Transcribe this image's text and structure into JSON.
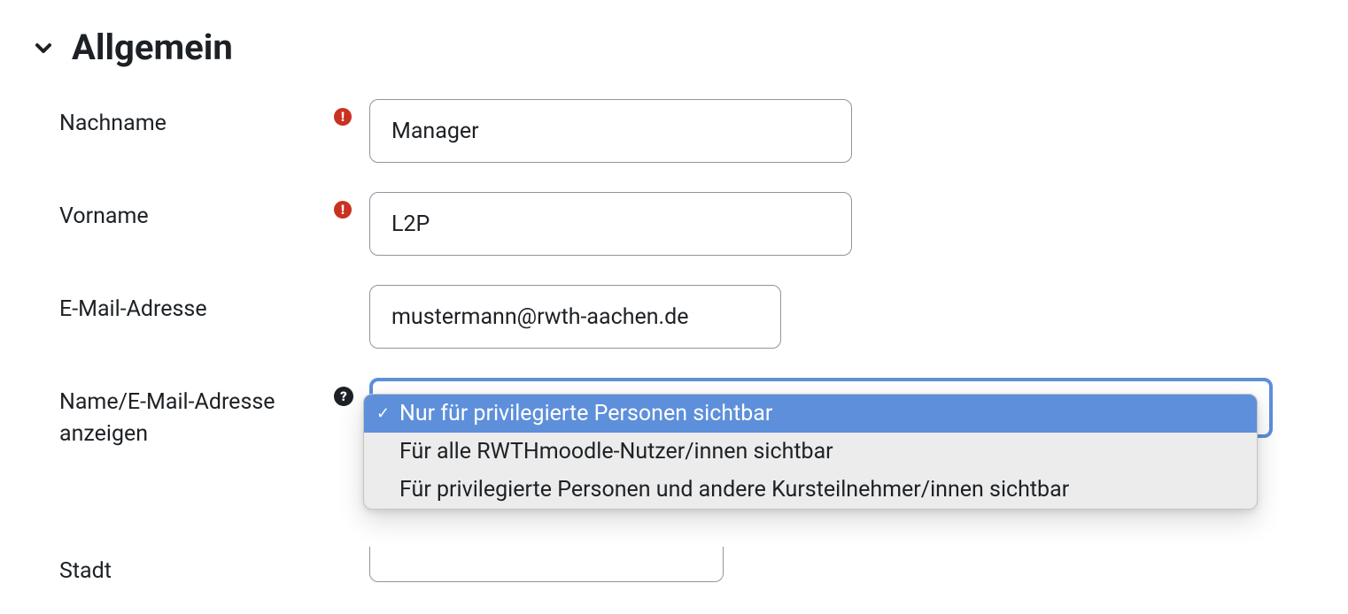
{
  "section": {
    "title": "Allgemein"
  },
  "fields": {
    "surname": {
      "label": "Nachname",
      "value": "Manager"
    },
    "firstname": {
      "label": "Vorname",
      "value": "L2P"
    },
    "email": {
      "label": "E-Mail-Adresse",
      "value": "mustermann@rwth-aachen.de"
    },
    "display": {
      "label": "Name/E-Mail-Adresse anzeigen",
      "options": [
        "Nur für privilegierte Personen sichtbar",
        "Für alle RWTHmoodle-Nutzer/innen sichtbar",
        "Für privilegierte Personen und andere Kursteilnehmer/innen sichtbar"
      ],
      "selected_index": 0
    },
    "city": {
      "label": "Stadt",
      "value": ""
    }
  }
}
